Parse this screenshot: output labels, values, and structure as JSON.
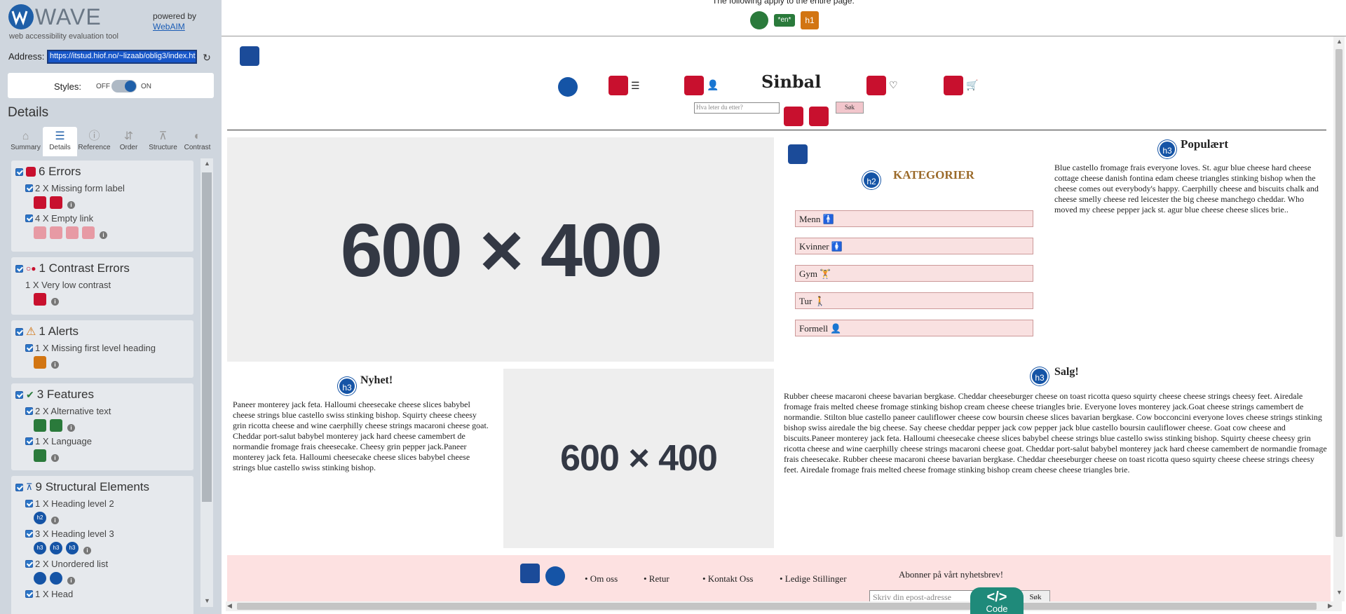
{
  "wave": {
    "logo_text": "WAVE",
    "tagline": "web accessibility evaluation tool",
    "powered_by": "powered by",
    "webaim": "WebAIM",
    "address_label": "Address:",
    "address_value": "https://itstud.hiof.no/~lizaab/oblig3/index.ht",
    "styles_label": "Styles:",
    "styles_off": "OFF",
    "styles_on": "ON",
    "details_title": "Details"
  },
  "tabs": [
    {
      "label": "Summary",
      "icon": "home-icon"
    },
    {
      "label": "Details",
      "icon": "list-icon"
    },
    {
      "label": "Reference",
      "icon": "info-icon"
    },
    {
      "label": "Order",
      "icon": "order-icon"
    },
    {
      "label": "Structure",
      "icon": "structure-icon"
    },
    {
      "label": "Contrast",
      "icon": "contrast-icon"
    }
  ],
  "sections": {
    "errors": {
      "title": "6 Errors",
      "items": [
        "2 X Missing form label",
        "4 X Empty link"
      ]
    },
    "contrast": {
      "title": "1 Contrast Errors",
      "items": [
        "1 X Very low contrast"
      ]
    },
    "alerts": {
      "title": "1 Alerts",
      "items": [
        "1 X Missing first level heading"
      ]
    },
    "features": {
      "title": "3 Features",
      "items": [
        "2 X Alternative text",
        "1 X Language"
      ]
    },
    "structural": {
      "title": "9 Structural Elements",
      "items": [
        "1 X Heading level 2",
        "3 X Heading level 3",
        "2 X Unordered list",
        "1 X Head"
      ]
    }
  },
  "topbar": {
    "text": "The following apply to the entire page:",
    "lang_badge": "*en*",
    "h1_badge": "h1"
  },
  "site": {
    "brand": "Sinbal",
    "search_placeholder": "Hva leter du etter?",
    "search_button": "Søk",
    "image_placeholder_1": "600 × 400",
    "image_placeholder_2": "600 × 400",
    "kategorier_title": "KATEGORIER",
    "kategorier": [
      "Menn 🚹",
      "Kvinner 🚺",
      "Gym 🏋",
      "Tur 🚶",
      "Formell 👤"
    ],
    "populaert_title": "Populært",
    "populaert_text": "Blue castello fromage frais everyone loves. St. agur blue cheese hard cheese cottage cheese danish fontina edam cheese triangles stinking bishop when the cheese comes out everybody's happy. Caerphilly cheese and biscuits chalk and cheese smelly cheese red leicester the big cheese manchego cheddar. Who moved my cheese pepper jack st. agur blue cheese cheese slices brie..",
    "nyhet_title": "Nyhet!",
    "nyhet_text": "Paneer monterey jack feta. Halloumi cheesecake cheese slices babybel cheese strings blue castello swiss stinking bishop. Squirty cheese cheesy grin ricotta cheese and wine caerphilly cheese strings macaroni cheese goat. Cheddar port-salut babybel monterey jack hard cheese camembert de normandie fromage frais cheesecake. Cheesy grin pepper jack.Paneer monterey jack feta. Halloumi cheesecake cheese slices babybel cheese strings blue castello swiss stinking bishop.",
    "salg_title": "Salg!",
    "salg_text": "Rubber cheese macaroni cheese bavarian bergkase. Cheddar cheeseburger cheese on toast ricotta queso squirty cheese cheese strings cheesy feet. Airedale fromage frais melted cheese fromage stinking bishop cream cheese cheese triangles brie. Everyone loves monterey jack.Goat cheese strings camembert de normandie. Stilton blue castello paneer cauliflower cheese cow boursin cheese slices bavarian bergkase. Cow bocconcini everyone loves cheese strings stinking bishop swiss airedale the big cheese. Say cheese cheddar pepper jack cow pepper jack blue castello boursin cauliflower cheese. Goat cow cheese and biscuits.Paneer monterey jack feta. Halloumi cheesecake cheese slices babybel cheese strings blue castello swiss stinking bishop. Squirty cheese cheesy grin ricotta cheese and wine caerphilly cheese strings macaroni cheese goat. Cheddar port-salut babybel monterey jack hard cheese camembert de normandie fromage frais cheesecake. Rubber cheese macaroni cheese bavarian bergkase. Cheddar cheeseburger cheese on toast ricotta queso squirty cheese cheese strings cheesy feet. Airedale fromage frais melted cheese fromage stinking bishop cream cheese cheese triangles brie.",
    "footer_links": [
      "• Om oss",
      "• Retur",
      "• Kontakt Oss",
      "• Ledige Stillinger"
    ],
    "newsletter_title": "Abonner på vårt nyhetsbrev!",
    "email_placeholder": "Skriv din epost-adresse",
    "newsletter_button": "Søk"
  },
  "badges": {
    "h2": "h2",
    "h3": "h3"
  },
  "code_button": {
    "symbol": "</>",
    "label": "Code"
  },
  "colors": {
    "error": "#c8102e",
    "alert": "#d27512",
    "feature": "#2a7a3b",
    "structure": "#1554a6",
    "sidebar": "#cfd6de"
  }
}
